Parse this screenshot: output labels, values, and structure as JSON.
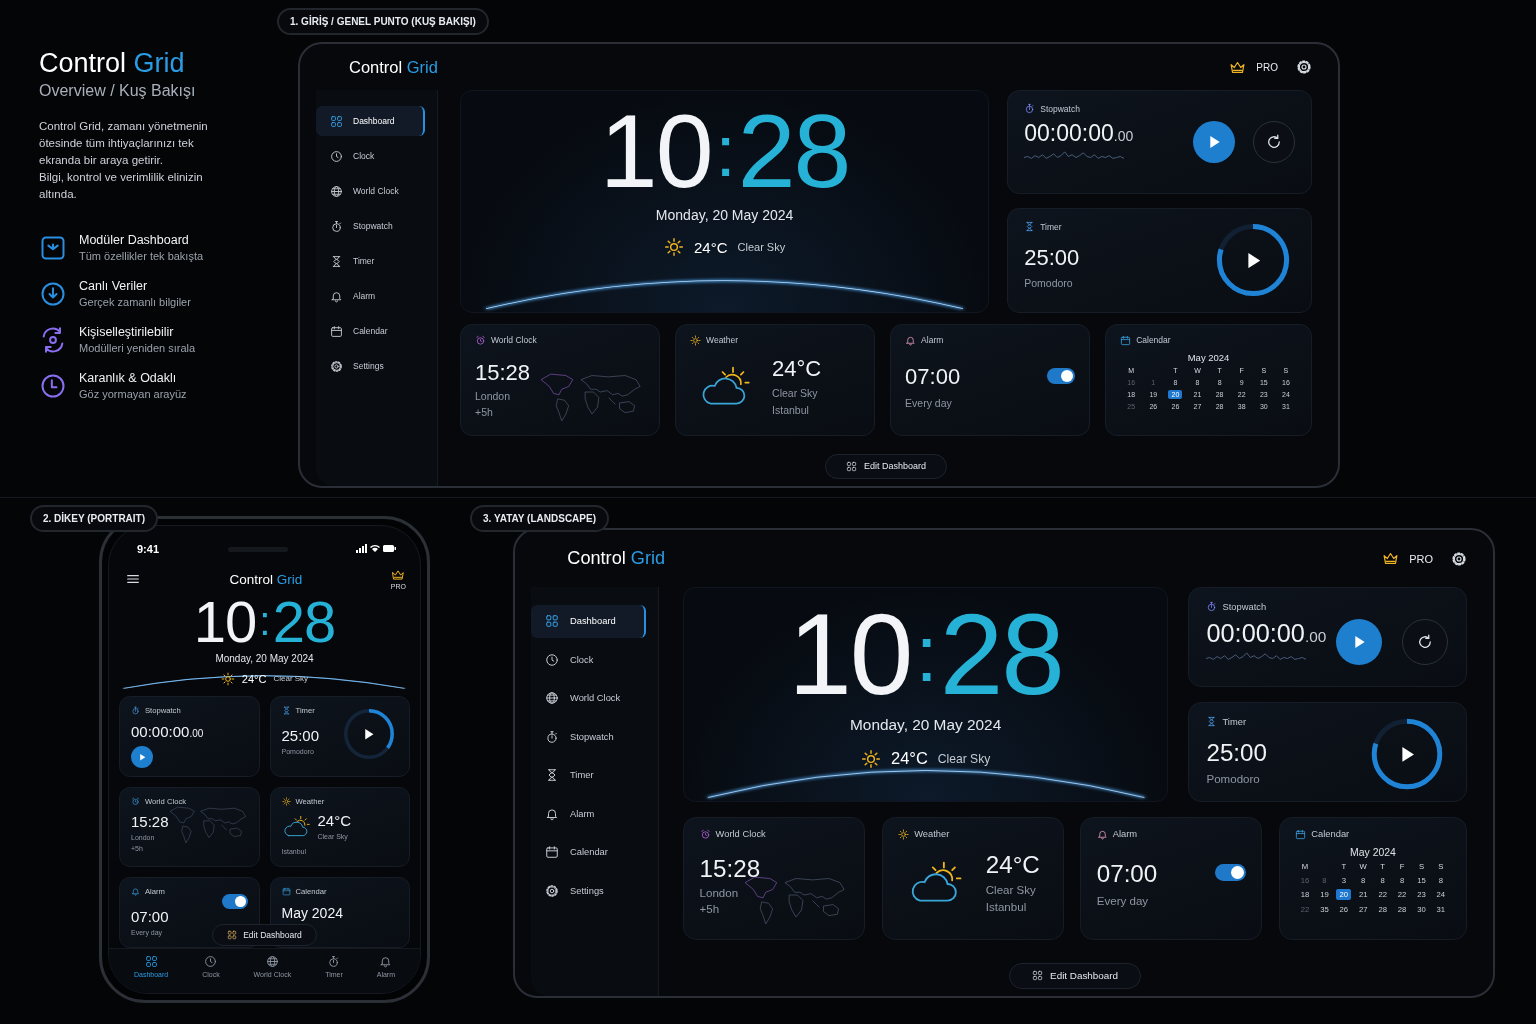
{
  "intro": {
    "title": "Control",
    "title_accent": "Grid",
    "subtitle": "Overview / Kuş Bakışı",
    "paragraphs": [
      "Control Grid, zamanı yönetmenin ötesinde tüm ihtiyaçlarınızı tek ekranda bir araya getirir.",
      "Bilgi, kontrol ve verimlilik elinizin altında."
    ],
    "features": [
      {
        "kind": "modules",
        "title": "Modüler Dashboard",
        "subtitle": "Tüm özellikler tek bakışta",
        "color": "#2a8fe0"
      },
      {
        "kind": "live",
        "title": "Canlı Veriler",
        "subtitle": "Gerçek zamanlı bilgiler",
        "color": "#2a8fe0"
      },
      {
        "kind": "custom",
        "title": "Kişiselleştirilebilir",
        "subtitle": "Modülleri yeniden sırala",
        "color": "#8a6ef0"
      },
      {
        "kind": "focus",
        "title": "Karanlık & Odaklı",
        "subtitle": "Göz yormayan arayüz",
        "color": "#8a6ef0"
      }
    ]
  },
  "overview": {
    "label": "1. GİRİŞ / GENEL PUNTO (KUŞ BAKIŞI)",
    "brand": "Control",
    "brand_accent": "Grid",
    "pro": "PRO",
    "nav": [
      {
        "kind": "dashboard",
        "label": "Dashboard",
        "selected": true
      },
      {
        "kind": "clock",
        "label": "Clock",
        "selected": false
      },
      {
        "kind": "world",
        "label": "World Clock",
        "selected": false
      },
      {
        "kind": "stopwatch",
        "label": "Stopwatch",
        "selected": false
      },
      {
        "kind": "timer",
        "label": "Timer",
        "selected": false
      },
      {
        "kind": "alarm",
        "label": "Alarm",
        "selected": false
      },
      {
        "kind": "calendar",
        "label": "Calendar",
        "selected": false
      },
      {
        "kind": "settings",
        "label": "Settings",
        "selected": false
      }
    ],
    "hero": {
      "hours": "10",
      "separator": ":",
      "minutes": "28",
      "date": "Monday, 20 May 2024",
      "temp": "24°C",
      "condition": "Clear Sky"
    },
    "stopwatch": {
      "title": "Stopwatch",
      "time": "00:00:00",
      "fraction": ".00"
    },
    "timer": {
      "title": "Timer",
      "time": "25:00",
      "caption": "Pomodoro",
      "level": 0.8
    },
    "world_clock": {
      "title": "World Clock",
      "time": "15:28",
      "city": "London",
      "offset": "+5h"
    },
    "weather": {
      "title": "Weather",
      "temp": "24°C",
      "condition": "Clear Sky",
      "city": "Istanbul"
    },
    "alarm": {
      "title": "Alarm",
      "time": "07:00",
      "repeat": "Every day",
      "on": true
    },
    "calendar": {
      "title": "Calendar",
      "month": "May 2024",
      "weekdays": [
        "M",
        "T",
        "W",
        "T",
        "F",
        "S",
        "S"
      ],
      "weeks": [
        [
          {
            "day": "16",
            "muted": true,
            "selected": false
          },
          {
            "day": "1",
            "muted": true,
            "selected": false
          },
          {
            "day": "8",
            "muted": false,
            "selected": false
          },
          {
            "day": "8",
            "muted": false,
            "selected": false
          },
          {
            "day": "8",
            "muted": false,
            "selected": false
          },
          {
            "day": "9",
            "muted": false,
            "selected": false
          },
          {
            "day": "15",
            "muted": false,
            "selected": false
          },
          {
            "day": "16",
            "muted": false,
            "selected": false
          }
        ],
        [
          {
            "day": "18",
            "muted": false,
            "selected": false
          },
          {
            "day": "19",
            "muted": false,
            "selected": false
          },
          {
            "day": "20",
            "muted": false,
            "selected": true
          },
          {
            "day": "21",
            "muted": false,
            "selected": false
          },
          {
            "day": "28",
            "muted": false,
            "selected": false
          },
          {
            "day": "22",
            "muted": false,
            "selected": false
          },
          {
            "day": "23",
            "muted": false,
            "selected": false
          },
          {
            "day": "24",
            "muted": false,
            "selected": false
          }
        ],
        [
          {
            "day": "25",
            "muted": true,
            "selected": false
          },
          {
            "day": "26",
            "muted": false,
            "selected": false
          },
          {
            "day": "26",
            "muted": false,
            "selected": false
          },
          {
            "day": "27",
            "muted": false,
            "selected": false
          },
          {
            "day": "28",
            "muted": false,
            "selected": false
          },
          {
            "day": "38",
            "muted": false,
            "selected": false
          },
          {
            "day": "30",
            "muted": false,
            "selected": false
          },
          {
            "day": "31",
            "muted": false,
            "selected": false
          }
        ]
      ]
    },
    "edit": "Edit Dashboard"
  },
  "portrait": {
    "label": "2. DİKEY (PORTRAIT)",
    "status_time": "9:41",
    "brand": "Control",
    "brand_accent": "Grid",
    "pro": "PRO",
    "hero": {
      "hours": "10",
      "separator": ":",
      "minutes": "28",
      "date": "Monday, 20 May 2024",
      "temp": "24°C",
      "condition": "Clear Sky"
    },
    "stopwatch": {
      "title": "Stopwatch",
      "time": "00:00:00",
      "fraction": ".00"
    },
    "timer": {
      "title": "Timer",
      "time": "25:00",
      "caption": "Pomodoro",
      "level": 0.35
    },
    "world_clock": {
      "title": "World Clock",
      "time": "15:28",
      "city": "London",
      "offset": "+5h"
    },
    "weather": {
      "title": "Weather",
      "temp": "24°C",
      "condition": "Clear Sky",
      "city": "Istanbul"
    },
    "alarm": {
      "title": "Alarm",
      "time": "07:00",
      "repeat": "Every day",
      "on": true
    },
    "calendar": {
      "title": "Calendar",
      "month": "May 2024"
    },
    "edit": "Edit Dashboard",
    "tabs": [
      {
        "kind": "dashboard",
        "label": "Dashboard",
        "selected": true
      },
      {
        "kind": "clock",
        "label": "Clock",
        "selected": false
      },
      {
        "kind": "world",
        "label": "World Clock",
        "selected": false
      },
      {
        "kind": "stopwatch",
        "label": "Timer",
        "selected": false
      },
      {
        "kind": "alarm",
        "label": "Alarm",
        "selected": false
      }
    ]
  },
  "landscape": {
    "label": "3. YATAY (LANDSCAPE)",
    "brand": "Control",
    "brand_accent": "Grid",
    "pro": "PRO",
    "nav": [
      {
        "kind": "dashboard",
        "label": "Dashboard",
        "selected": true
      },
      {
        "kind": "clock",
        "label": "Clock",
        "selected": false
      },
      {
        "kind": "world",
        "label": "World Clock",
        "selected": false
      },
      {
        "kind": "stopwatch",
        "label": "Stopwatch",
        "selected": false
      },
      {
        "kind": "timer",
        "label": "Timer",
        "selected": false
      },
      {
        "kind": "alarm",
        "label": "Alarm",
        "selected": false
      },
      {
        "kind": "calendar",
        "label": "Calendar",
        "selected": false
      },
      {
        "kind": "settings",
        "label": "Settings",
        "selected": false
      }
    ],
    "hero": {
      "hours": "10",
      "separator": ":",
      "minutes": "28",
      "date": "Monday, 20 May 2024",
      "temp": "24°C",
      "condition": "Clear Sky"
    },
    "stopwatch": {
      "title": "Stopwatch",
      "time": "00:00:00",
      "fraction": ".00"
    },
    "timer": {
      "title": "Timer",
      "time": "25:00",
      "caption": "Pomodoro",
      "level": 0.8
    },
    "world_clock": {
      "title": "World Clock",
      "time": "15:28",
      "city": "London",
      "offset": "+5h"
    },
    "weather": {
      "title": "Weather",
      "temp": "24°C",
      "condition": "Clear Sky",
      "city": "Istanbul"
    },
    "alarm": {
      "title": "Alarm",
      "time": "07:00",
      "repeat": "Every day",
      "on": true
    },
    "calendar": {
      "title": "Calendar",
      "month": "May 2024",
      "weekdays": [
        "M",
        "T",
        "W",
        "T",
        "F",
        "S",
        "S"
      ],
      "weeks": [
        [
          {
            "day": "16",
            "muted": true,
            "selected": false
          },
          {
            "day": "8",
            "muted": true,
            "selected": false
          },
          {
            "day": "3",
            "muted": false,
            "selected": false
          },
          {
            "day": "8",
            "muted": false,
            "selected": false
          },
          {
            "day": "8",
            "muted": false,
            "selected": false
          },
          {
            "day": "8",
            "muted": false,
            "selected": false
          },
          {
            "day": "15",
            "muted": false,
            "selected": false
          },
          {
            "day": "8",
            "muted": false,
            "selected": false
          }
        ],
        [
          {
            "day": "18",
            "muted": false,
            "selected": false
          },
          {
            "day": "19",
            "muted": false,
            "selected": false
          },
          {
            "day": "20",
            "muted": false,
            "selected": true
          },
          {
            "day": "21",
            "muted": false,
            "selected": false
          },
          {
            "day": "22",
            "muted": false,
            "selected": false
          },
          {
            "day": "22",
            "muted": false,
            "selected": false
          },
          {
            "day": "23",
            "muted": false,
            "selected": false
          },
          {
            "day": "24",
            "muted": false,
            "selected": false
          }
        ],
        [
          {
            "day": "22",
            "muted": true,
            "selected": false
          },
          {
            "day": "35",
            "muted": false,
            "selected": false
          },
          {
            "day": "26",
            "muted": false,
            "selected": false
          },
          {
            "day": "27",
            "muted": false,
            "selected": false
          },
          {
            "day": "28",
            "muted": false,
            "selected": false
          },
          {
            "day": "28",
            "muted": false,
            "selected": false
          },
          {
            "day": "30",
            "muted": false,
            "selected": false
          },
          {
            "day": "31",
            "muted": false,
            "selected": false
          }
        ]
      ]
    },
    "edit": "Edit Dashboard"
  }
}
